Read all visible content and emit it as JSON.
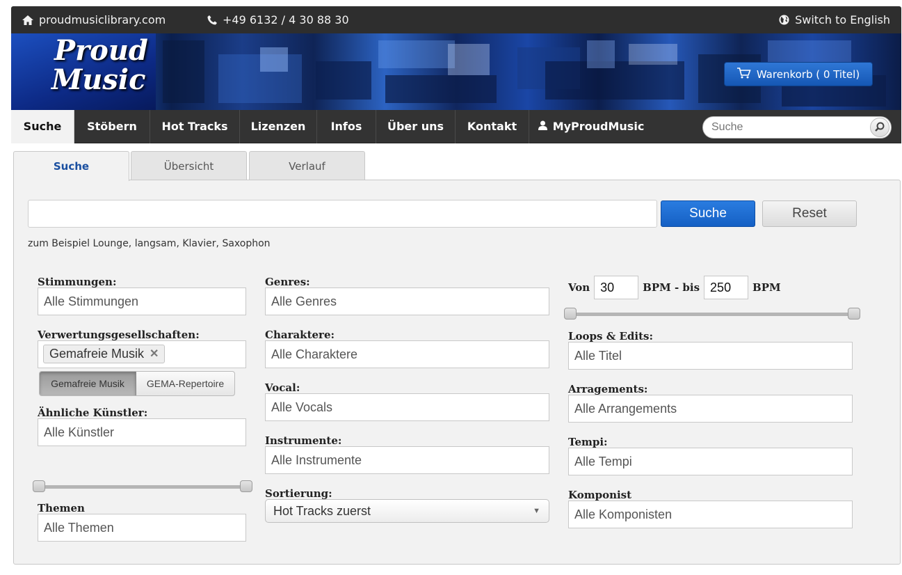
{
  "topbar": {
    "site": "proudmusiclibrary.com",
    "phone": "+49 6132 / 4 30 88 30",
    "language_switch": "Switch to English"
  },
  "banner": {
    "logo_line1": "Proud",
    "logo_line2": "Music",
    "cart_label": "Warenkorb ( 0 Titel)"
  },
  "nav": {
    "items": [
      "Suche",
      "Stöbern",
      "Hot Tracks",
      "Lizenzen",
      "Infos",
      "Über uns",
      "Kontakt",
      "MyProudMusic"
    ],
    "active": "Suche",
    "search_placeholder": "Suche"
  },
  "tabs": [
    "Suche",
    "Übersicht",
    "Verlauf"
  ],
  "search": {
    "value": "",
    "button": "Suche",
    "reset": "Reset",
    "hint": "zum Beispiel Lounge, langsam, Klavier, Saxophon"
  },
  "filters": {
    "stimmungen": {
      "label": "Stimmungen:",
      "value": "Alle Stimmungen"
    },
    "verwertung": {
      "label": "Verwertungsgesellschaften:",
      "chip": "Gemafreie Musik",
      "chip_remove": "✕",
      "toggle_on": "Gemafreie Musik",
      "toggle_off": "GEMA-Repertoire"
    },
    "kuenstler": {
      "label": "Ähnliche Künstler:",
      "value": "Alle Künstler"
    },
    "themen": {
      "label": "Themen",
      "value": "Alle Themen"
    },
    "genres": {
      "label": "Genres:",
      "value": "Alle Genres"
    },
    "charaktere": {
      "label": "Charaktere:",
      "value": "Alle Charaktere"
    },
    "vocal": {
      "label": "Vocal:",
      "value": "Alle Vocals"
    },
    "instrumente": {
      "label": "Instrumente:",
      "value": "Alle Instrumente"
    },
    "sortierung": {
      "label": "Sortierung:",
      "value": "Hot Tracks zuerst"
    },
    "bpm": {
      "von": "Von",
      "from_value": "30",
      "mid": "BPM - bis",
      "to_value": "250",
      "unit": "BPM"
    },
    "loops": {
      "label": "Loops & Edits:",
      "value": "Alle Titel"
    },
    "arrangements": {
      "label": "Arragements:",
      "value": "Alle Arrangements"
    },
    "tempi": {
      "label": "Tempi:",
      "value": "Alle Tempi"
    },
    "komponist": {
      "label": "Komponist",
      "value": "Alle Komponisten"
    }
  },
  "colors": {
    "accent": "#1560c4",
    "nav_bg": "#333333",
    "panel_bg": "#f2f2f2",
    "banner_blue": "#1d4fb4"
  }
}
